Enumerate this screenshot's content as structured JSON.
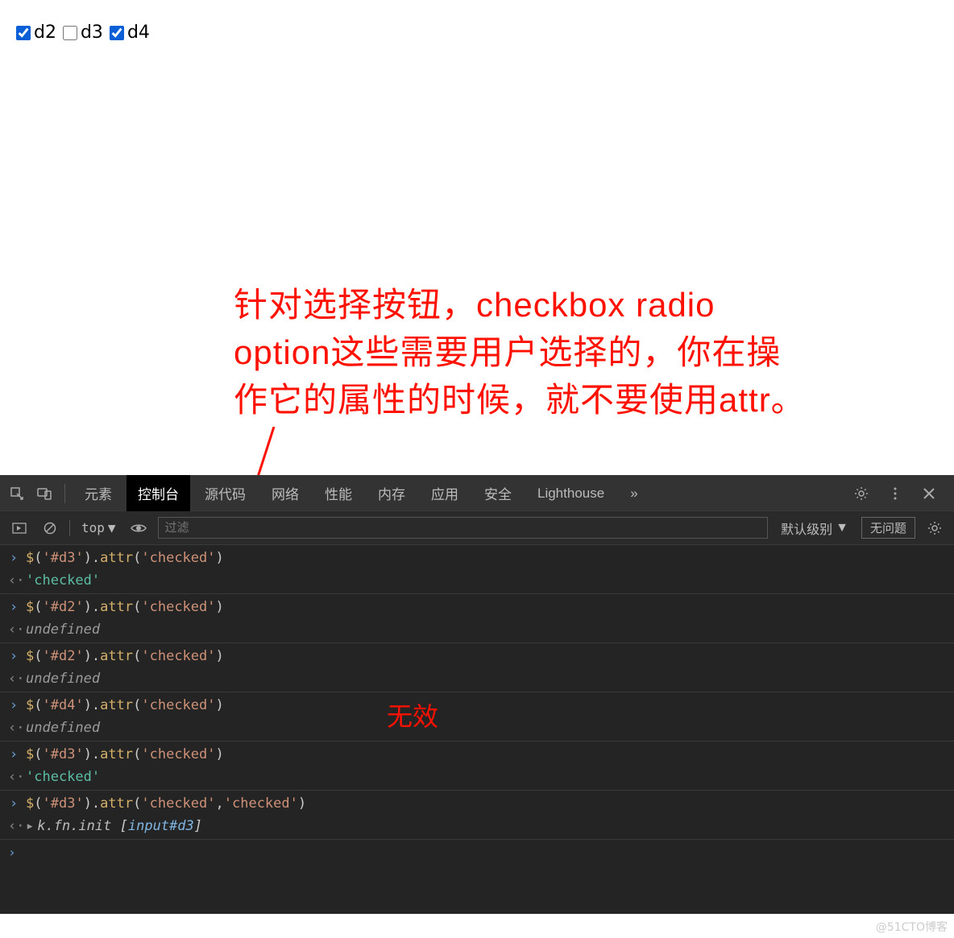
{
  "checkboxes": [
    {
      "label": "d2",
      "checked": true
    },
    {
      "label": "d3",
      "checked": false
    },
    {
      "label": "d4",
      "checked": true
    }
  ],
  "annotation": {
    "line1": "针对选择按钮，checkbox radio",
    "line2": "option这些需要用户选择的，你在操",
    "line3": "作它的属性的时候，就不要使用attr。",
    "invalid": "无效"
  },
  "devtools": {
    "tabs": [
      "元素",
      "控制台",
      "源代码",
      "网络",
      "性能",
      "内存",
      "应用",
      "安全",
      "Lighthouse"
    ],
    "activeTab": 1,
    "more": "»",
    "toolbar": {
      "context": "top",
      "filterPlaceholder": "过滤",
      "level": "默认级别",
      "noIssues": "无问题"
    },
    "console": [
      {
        "in": "$('#d3').attr('checked')",
        "out_type": "string",
        "out": "'checked'"
      },
      {
        "in": "$('#d2').attr('checked')",
        "out_type": "undef",
        "out": "undefined"
      },
      {
        "in": "$('#d2').attr('checked')",
        "out_type": "undef",
        "out": "undefined"
      },
      {
        "in": "$('#d4').attr('checked')",
        "out_type": "undef",
        "out": "undefined"
      },
      {
        "in": "$('#d3').attr('checked')",
        "out_type": "string",
        "out": "'checked'"
      },
      {
        "in": "$('#d3').attr('checked','checked')",
        "out_type": "init",
        "out": "k.fn.init [input#d3]"
      }
    ]
  },
  "watermark": "@51CTO博客"
}
